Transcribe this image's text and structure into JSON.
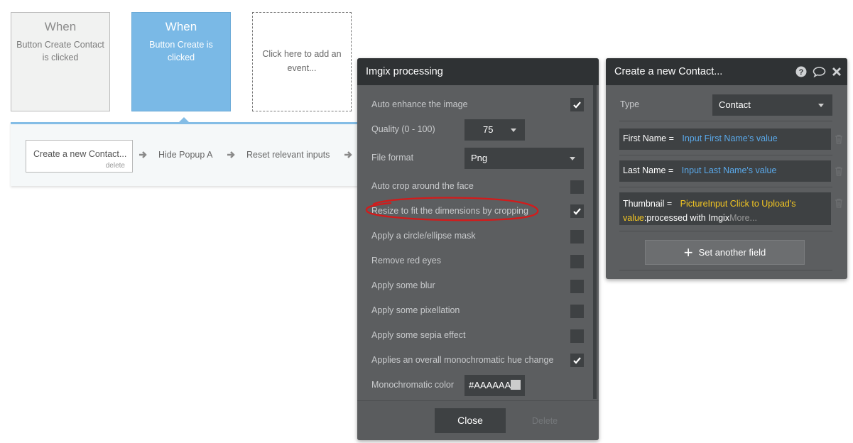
{
  "events": [
    {
      "title": "When",
      "subtitle": "Button Create Contact is clicked"
    },
    {
      "title": "When",
      "subtitle": "Button Create is clicked"
    },
    {
      "subtitle": "Click here to add an event..."
    }
  ],
  "actions": {
    "first": {
      "label": "Create a new Contact...",
      "delete_label": "delete"
    },
    "second": "Hide Popup A",
    "third": "Reset relevant inputs"
  },
  "imgix": {
    "title": "Imgix processing",
    "rows": {
      "auto_enhance": {
        "label": "Auto enhance the image",
        "checked": true
      },
      "quality": {
        "label": "Quality (0 - 100)",
        "value": "75"
      },
      "file_format": {
        "label": "File format",
        "value": "Png"
      },
      "auto_crop": {
        "label": "Auto crop around the face",
        "checked": false
      },
      "resize": {
        "label": "Resize to fit the dimensions by cropping",
        "checked": true
      },
      "circle_mask": {
        "label": "Apply a circle/ellipse mask",
        "checked": false
      },
      "red_eyes": {
        "label": "Remove red eyes",
        "checked": false
      },
      "blur": {
        "label": "Apply some blur",
        "checked": false
      },
      "pixellation": {
        "label": "Apply some pixellation",
        "checked": false
      },
      "sepia": {
        "label": "Apply some sepia effect",
        "checked": false
      },
      "monochrome": {
        "label": "Applies an overall monochromatic hue change",
        "checked": true
      },
      "mono_color": {
        "label": "Monochromatic color",
        "value": "#AAAAAA",
        "swatch": "#cccccc"
      }
    },
    "close_label": "Close",
    "delete_label": "Delete",
    "annotation_color": "#d31b1b"
  },
  "create": {
    "title": "Create a new Contact...",
    "type_label": "Type",
    "type_value": "Contact",
    "fields": {
      "first": {
        "name": "First Name =",
        "value": "Input First Name's value"
      },
      "last": {
        "name": "Last Name =",
        "value": "Input Last Name's value"
      },
      "thumb": {
        "name": "Thumbnail =",
        "value": "PictureInput Click to Upload's value",
        "suffix": ":processed with Imgix",
        "more": "More..."
      }
    },
    "set_another_label": "Set another field"
  }
}
